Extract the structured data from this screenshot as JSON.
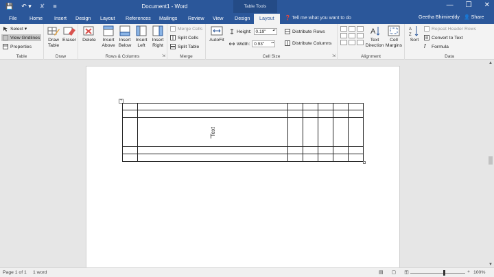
{
  "window": {
    "title": "Document1 - Word",
    "table_tools_label": "Table Tools",
    "minimize": "—",
    "restore": "❒",
    "close": "✕"
  },
  "qat": {
    "save": "💾",
    "undo": "↶ ▾",
    "redo": "✘",
    "customize": "≡"
  },
  "tabs": [
    {
      "label": "File"
    },
    {
      "label": "Home"
    },
    {
      "label": "Insert"
    },
    {
      "label": "Design"
    },
    {
      "label": "Layout"
    },
    {
      "label": "References"
    },
    {
      "label": "Mailings"
    },
    {
      "label": "Review"
    },
    {
      "label": "View"
    },
    {
      "label": "Design"
    },
    {
      "label": "Layout"
    }
  ],
  "tell_me": "❓ Tell me what you want to do",
  "user_name": "Geetha Bhimireddy",
  "share_label": "👤 Share",
  "ribbon": {
    "table": {
      "select": "Select ▾",
      "view_gridlines": "View Gridlines",
      "properties": "Properties",
      "label": "Table"
    },
    "draw": {
      "draw_table": "Draw Table",
      "eraser": "Eraser",
      "label": "Draw"
    },
    "rows_columns": {
      "delete": "Delete",
      "insert_above": "Insert Above",
      "insert_below": "Insert Below",
      "insert_left": "Insert Left",
      "insert_right": "Insert Right",
      "label": "Rows & Columns"
    },
    "merge": {
      "merge_cells": "Merge Cells",
      "split_cells": "Split Cells",
      "split_table": "Split Table",
      "label": "Merge"
    },
    "cell_size": {
      "autofit": "AutoFit",
      "height_label": "Height:",
      "height_value": "0.19\"",
      "width_label": "Width:",
      "width_value": "0.93\"",
      "distribute_rows": "Distribute Rows",
      "distribute_columns": "Distribute Columns",
      "label": "Cell Size"
    },
    "alignment": {
      "text_direction": "Text Direction",
      "cell_margins": "Cell Margins",
      "label": "Alignment"
    },
    "data": {
      "sort": "Sort",
      "repeat_header_rows": "Repeat Header Rows",
      "convert_to_text": "Convert to Text",
      "formula": "Formula",
      "label": "Data"
    }
  },
  "document": {
    "cell_text": "Text"
  },
  "status": {
    "page": "Page 1 of 1",
    "words": "1 word",
    "zoom": "100%",
    "zoom_minus": "−",
    "zoom_plus": "+"
  }
}
